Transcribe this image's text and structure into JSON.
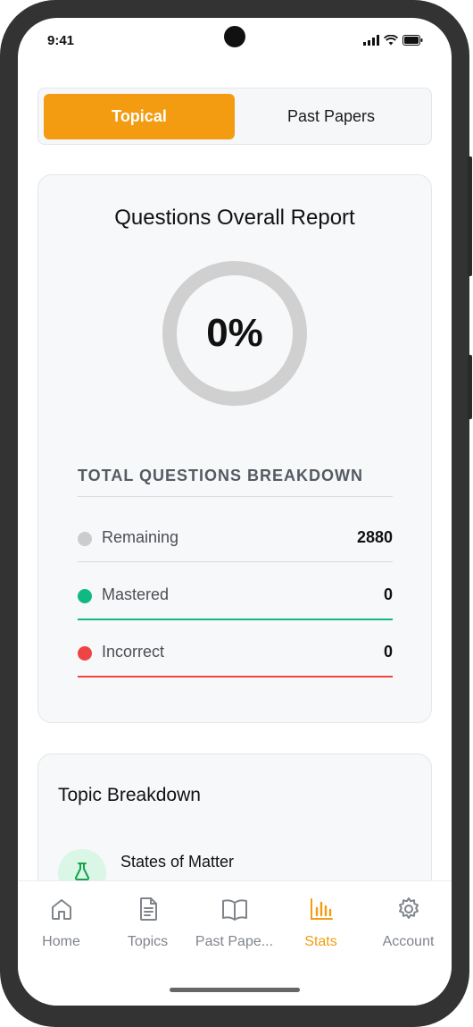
{
  "status_bar": {
    "time": "9:41"
  },
  "tabs": [
    {
      "label": "Topical",
      "active": true
    },
    {
      "label": "Past Papers",
      "active": false
    }
  ],
  "report": {
    "title": "Questions Overall Report",
    "progress_percent": 0,
    "progress_label": "0%",
    "breakdown_heading": "TOTAL QUESTIONS BREAKDOWN",
    "rows": [
      {
        "label": "Remaining",
        "value": "2880",
        "color": "#cccccc"
      },
      {
        "label": "Mastered",
        "value": "0",
        "color": "#10b981"
      },
      {
        "label": "Incorrect",
        "value": "0",
        "color": "#ef4444"
      }
    ]
  },
  "topic_breakdown": {
    "title": "Topic Breakdown",
    "items": [
      {
        "name": "States of Matter",
        "icon": "flask-icon",
        "accent": "#16a34a"
      }
    ]
  },
  "bottom_nav": [
    {
      "label": "Home",
      "icon": "home-icon",
      "active": false
    },
    {
      "label": "Topics",
      "icon": "document-icon",
      "active": false
    },
    {
      "label": "Past Pape...",
      "icon": "book-icon",
      "active": false
    },
    {
      "label": "Stats",
      "icon": "bar-chart-icon",
      "active": true
    },
    {
      "label": "Account",
      "icon": "gear-icon",
      "active": false
    }
  ],
  "colors": {
    "accent": "#f39c12",
    "ring_track": "#d0d0d0"
  }
}
